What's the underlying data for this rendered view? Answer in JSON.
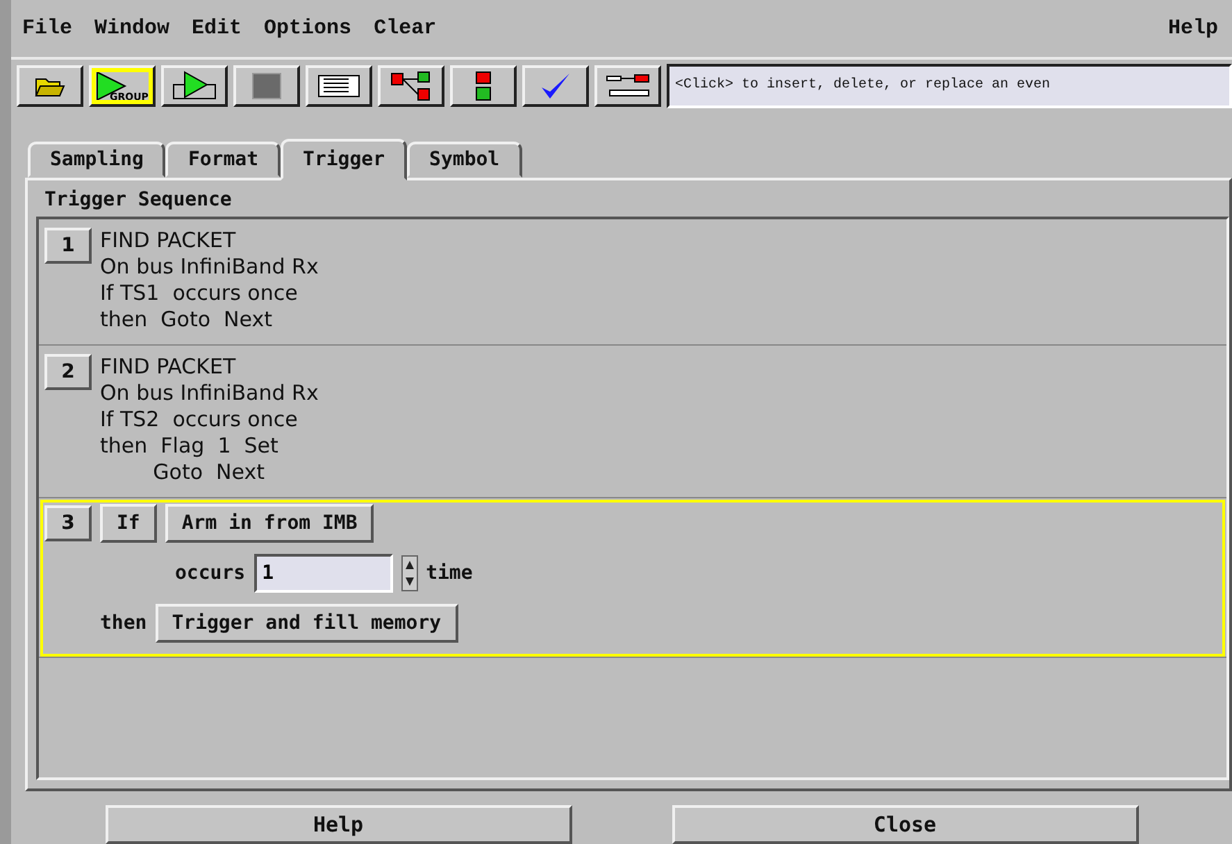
{
  "menu": {
    "items": [
      "File",
      "Window",
      "Edit",
      "Options",
      "Clear"
    ],
    "help": "Help"
  },
  "toolbar": {
    "tools": [
      {
        "kind": "open",
        "selected": false
      },
      {
        "kind": "group-run",
        "label": "GROUP",
        "selected": true
      },
      {
        "kind": "repeat-run",
        "selected": false
      },
      {
        "kind": "stop",
        "selected": false
      },
      {
        "kind": "listing",
        "selected": false
      },
      {
        "kind": "tree",
        "selected": false
      },
      {
        "kind": "chain",
        "selected": false
      },
      {
        "kind": "check",
        "selected": false
      },
      {
        "kind": "tools",
        "selected": false
      }
    ],
    "hint": "<Click> to insert, delete, or replace an even"
  },
  "tabs": [
    {
      "label": "Sampling",
      "selected": false
    },
    {
      "label": "Format",
      "selected": false
    },
    {
      "label": "Trigger",
      "selected": true
    },
    {
      "label": "Symbol",
      "selected": false
    }
  ],
  "sequence": {
    "title": "Trigger Sequence",
    "steps": [
      {
        "kind": "summary",
        "number": "1",
        "selected": false,
        "lines": [
          "FIND PACKET",
          "On bus InfiniBand Rx",
          "If TS1  occurs once",
          "then  Goto  Next"
        ]
      },
      {
        "kind": "summary",
        "number": "2",
        "selected": false,
        "lines": [
          "FIND PACKET",
          "On bus InfiniBand Rx",
          "If TS2  occurs once",
          "then  Flag  1  Set",
          "        Goto  Next"
        ]
      },
      {
        "kind": "editor",
        "number": "3",
        "selected": true,
        "condition": "If",
        "event": "Arm in from IMB",
        "occurs_label": "occurs",
        "count": "1",
        "unit": "time",
        "then_label": "then",
        "action": "Trigger and fill memory"
      }
    ]
  },
  "buttons": [
    "Help",
    "Close"
  ]
}
